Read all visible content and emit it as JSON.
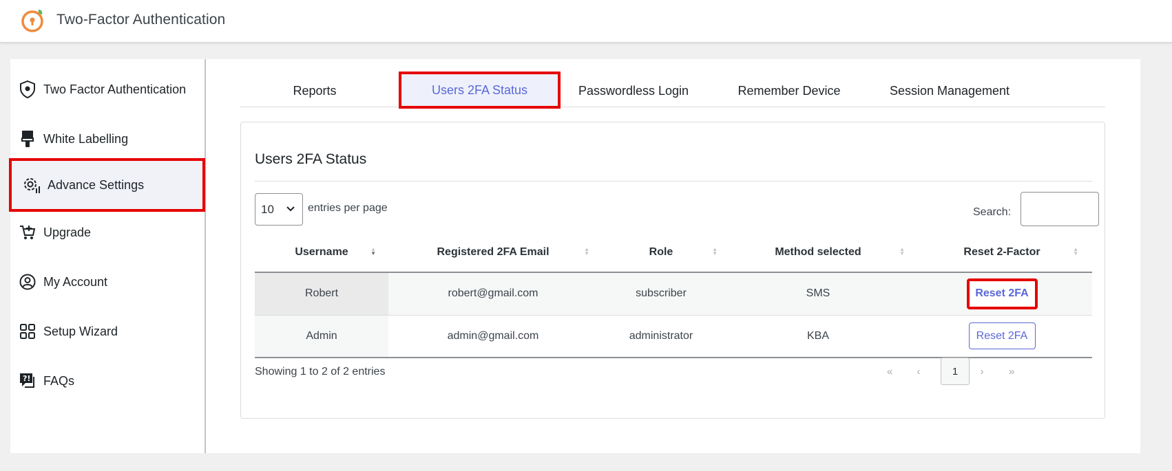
{
  "header": {
    "title": "Two-Factor Authentication"
  },
  "sidebar": {
    "items": [
      {
        "label": "Two Factor Authentication",
        "icon": "shield-icon"
      },
      {
        "label": "White Labelling",
        "icon": "paint-brush-icon"
      },
      {
        "label": "Advance Settings",
        "icon": "gear-icon",
        "active": true
      },
      {
        "label": "Upgrade",
        "icon": "cart-icon"
      },
      {
        "label": "My Account",
        "icon": "user-circle-icon"
      },
      {
        "label": "Setup Wizard",
        "icon": "grid-icon"
      },
      {
        "label": "FAQs",
        "icon": "question-chat-icon"
      }
    ]
  },
  "tabs": [
    {
      "label": "Reports"
    },
    {
      "label": "Users 2FA Status",
      "active": true
    },
    {
      "label": "Passwordless Login"
    },
    {
      "label": "Remember Device"
    },
    {
      "label": "Session Management"
    }
  ],
  "card": {
    "title": "Users 2FA Status",
    "entries_value": "10",
    "entries_label": "entries per page",
    "search_label": "Search:",
    "search_value": "",
    "columns": [
      "Username",
      "Registered 2FA Email",
      "Role",
      "Method selected",
      "Reset 2-Factor"
    ],
    "rows": [
      {
        "username": "Robert",
        "email": "robert@gmail.com",
        "role": "subscriber",
        "method": "SMS",
        "action": "Reset 2FA"
      },
      {
        "username": "Admin",
        "email": "admin@gmail.com",
        "role": "administrator",
        "method": "KBA",
        "action": "Reset 2FA"
      }
    ],
    "showing": "Showing 1 to 2 of 2 entries",
    "pager": {
      "first": "«",
      "prev": "‹",
      "current": "1",
      "next": "›",
      "last": "»"
    }
  },
  "colors": {
    "accent": "#5a67d8",
    "highlight": "#e60000"
  }
}
